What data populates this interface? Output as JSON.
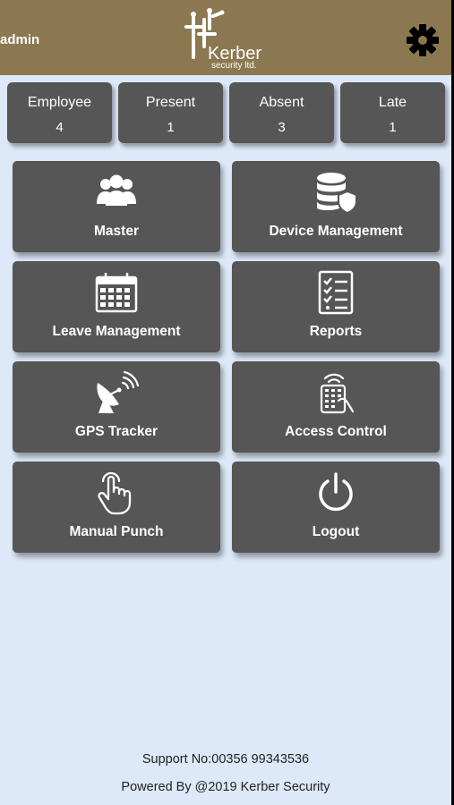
{
  "header": {
    "user": "admin",
    "logo_name": "Kerber",
    "logo_sub": "security ltd."
  },
  "stats": [
    {
      "label": "Employee",
      "value": "4"
    },
    {
      "label": "Present",
      "value": "1"
    },
    {
      "label": "Absent",
      "value": "3"
    },
    {
      "label": "Late",
      "value": "1"
    }
  ],
  "tiles": [
    {
      "label": "Master",
      "icon": "users-group-icon"
    },
    {
      "label": "Device Management",
      "icon": "database-shield-icon"
    },
    {
      "label": "Leave Management",
      "icon": "calendar-icon"
    },
    {
      "label": "Reports",
      "icon": "checklist-icon"
    },
    {
      "label": "GPS Tracker",
      "icon": "satellite-dish-icon"
    },
    {
      "label": "Access Control",
      "icon": "keypad-access-icon"
    },
    {
      "label": "Manual Punch",
      "icon": "finger-tap-icon"
    },
    {
      "label": "Logout",
      "icon": "power-icon"
    }
  ],
  "footer": {
    "support": "Support No:00356 99343536",
    "powered": "Powered By @2019 Kerber Security"
  },
  "colors": {
    "header_bg": "#8c7850",
    "page_bg": "#dde9f8",
    "tile_bg": "#565656"
  }
}
